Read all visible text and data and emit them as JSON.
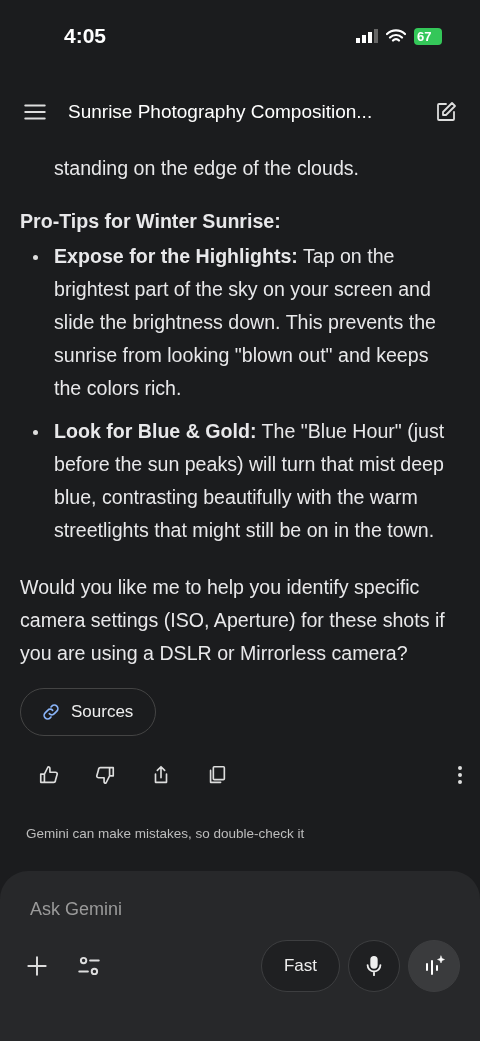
{
  "status_bar": {
    "time": "4:05",
    "battery": "67"
  },
  "header": {
    "title": "Sunrise Photography Composition..."
  },
  "content": {
    "continued_text": "standing on the edge of the clouds.",
    "heading": "Pro-Tips for Winter Sunrise:",
    "bullets": [
      {
        "text": "**Expose for the Highlights:** Tap on the brightest part of the sky on your screen and slide the brightness down. This prevents the sunrise from looking \"blown out\" and keeps the colors rich."
      },
      {
        "text": "**Look for Blue & Gold:** The \"Blue Hour\" (just before the sun peaks) will turn that mist deep blue, contrasting beautifully with the warm streetlights that might still be on in the town."
      }
    ],
    "question": "Would you like me to help you identify specific camera settings (ISO, Aperture) for these shots if you are using a DSLR or Mirrorless camera?",
    "sources_button": "Sources"
  },
  "disclaimer": "Gemini can make mistakes, so double-check it",
  "composer": {
    "placeholder": "Ask Gemini",
    "mode_button": "Fast"
  }
}
